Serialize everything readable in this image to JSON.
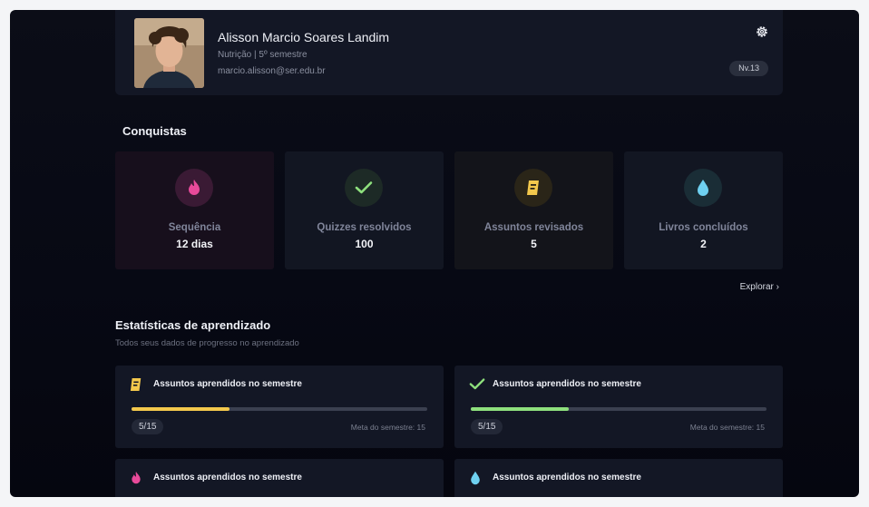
{
  "profile": {
    "name": "Alisson Marcio Soares Landim",
    "course": "Nutrição | 5º semestre",
    "email": "marcio.alisson@ser.edu.br",
    "level": "Nv.13",
    "settings_icon": "gear-icon"
  },
  "achievements": {
    "title": "Conquistas",
    "items": [
      {
        "label": "Sequência",
        "value": "12 dias",
        "icon": "flame-icon",
        "color": "#e84a9a"
      },
      {
        "label": "Quizzes resolvidos",
        "value": "100",
        "icon": "check-icon",
        "color": "#8ee07d"
      },
      {
        "label": "Assuntos revisados",
        "value": "5",
        "icon": "document-icon",
        "color": "#f3c84c"
      },
      {
        "label": "Livros concluídos",
        "value": "2",
        "icon": "drop-icon",
        "color": "#6ed0f0"
      }
    ],
    "explore_label": "Explorar ›"
  },
  "stats": {
    "title": "Estatísticas de aprendizado",
    "subtitle": "Todos seus dados de progresso no aprendizado",
    "cards": [
      {
        "title": "Assuntos aprendidos no semestre",
        "count": "5/15",
        "goal": "Meta do semestre: 15",
        "progress": 0.33,
        "icon": "document-icon",
        "color": "#f3c84c"
      },
      {
        "title": "Assuntos aprendidos no semestre",
        "count": "5/15",
        "goal": "Meta do semestre: 15",
        "progress": 0.33,
        "icon": "check-icon",
        "color": "#8ee07d"
      },
      {
        "title": "Assuntos aprendidos no semestre",
        "icon": "flame-icon",
        "color": "#e84a9a"
      },
      {
        "title": "Assuntos aprendidos no semestre",
        "icon": "drop-icon",
        "color": "#6ed0f0"
      }
    ]
  }
}
